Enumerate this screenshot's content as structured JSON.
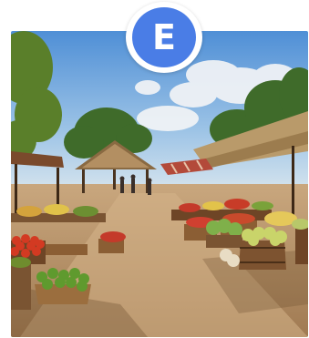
{
  "badge": {
    "letter": "E",
    "color": "#4a7de6"
  },
  "scene": {
    "icon": "farmers-market-photo"
  }
}
